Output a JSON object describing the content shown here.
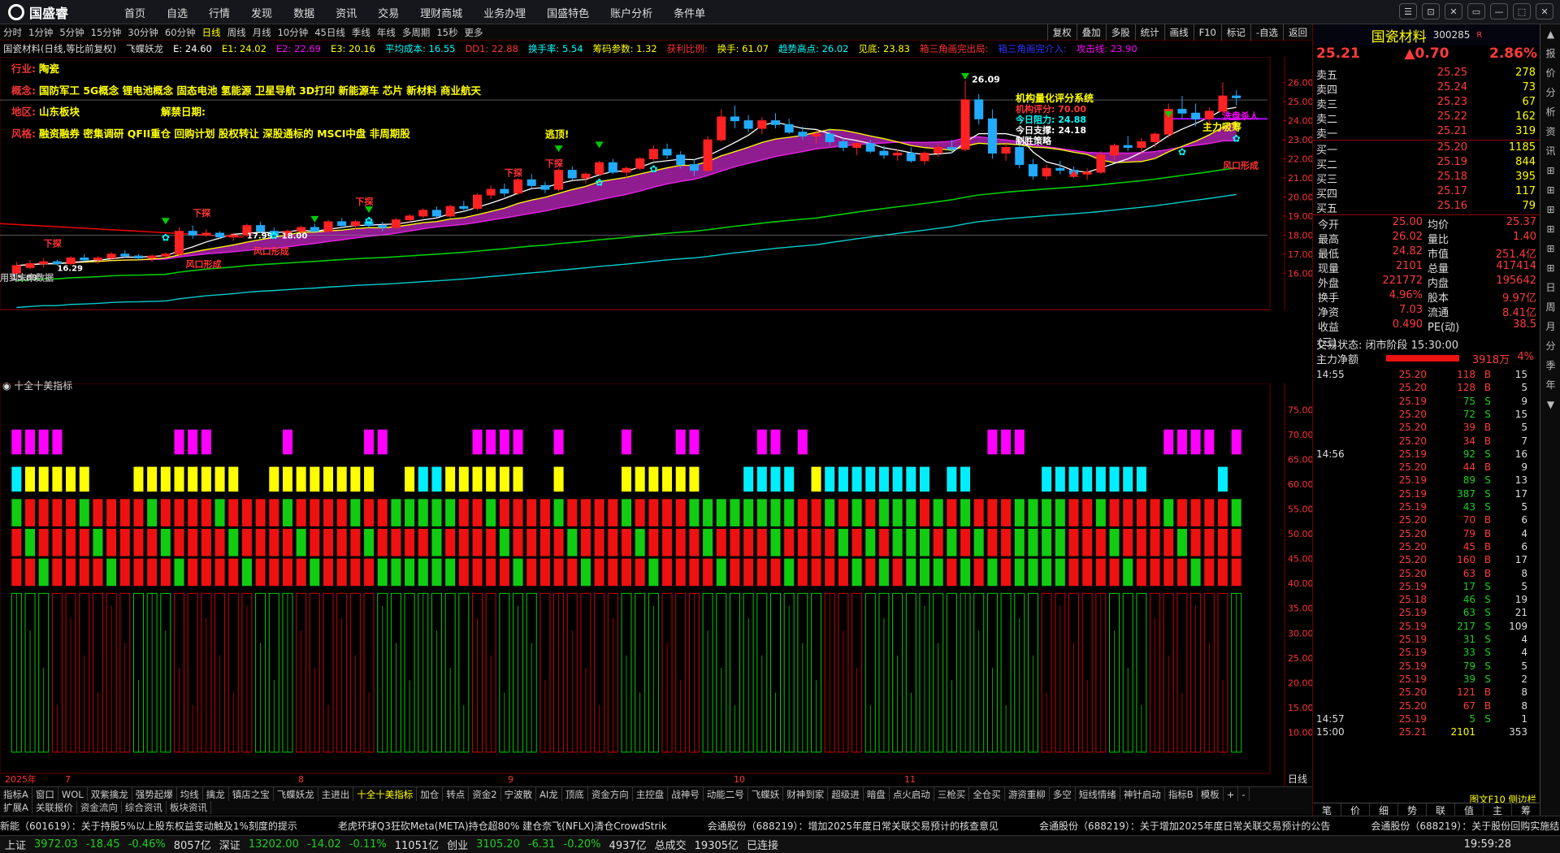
{
  "app": {
    "logo": "国盛睿"
  },
  "menu": [
    "首页",
    "自选",
    "行情",
    "发现",
    "数据",
    "资讯",
    "交易",
    "理财商城",
    "业务办理",
    "国盛特色",
    "账户分析",
    "条件单"
  ],
  "window_buttons": [
    "☰",
    "⊡",
    "✕",
    "▭",
    "—",
    "⬚",
    "✕"
  ],
  "periods": [
    "分时",
    "1分钟",
    "5分钟",
    "15分钟",
    "30分钟",
    "60分钟",
    "日线",
    "周线",
    "月线",
    "10分钟",
    "45日线",
    "季线",
    "年线",
    "多周期",
    "15秒",
    "更多"
  ],
  "active_period": "日线",
  "right_tools": [
    "复权",
    "叠加",
    "多股",
    "统计",
    "画线",
    "F10",
    "标记",
    "-自选",
    "返回"
  ],
  "indicator_line": [
    {
      "t": "国瓷材料(日线,等比前复权)",
      "c": "#ddd"
    },
    {
      "t": "飞蝶妖龙",
      "c": "#ddd"
    },
    {
      "t": "E: 24.60",
      "c": "#fff"
    },
    {
      "t": "E1: 24.02",
      "c": "#ff0"
    },
    {
      "t": "E2: 22.69",
      "c": "#f0f"
    },
    {
      "t": "E3: 20.16",
      "c": "#ff0"
    },
    {
      "t": "平均成本: 16.55",
      "c": "#0ff"
    },
    {
      "t": "DD1: 22.88",
      "c": "#f33"
    },
    {
      "t": "换手率: 5.54",
      "c": "#0ff"
    },
    {
      "t": "筹码参数: 1.32",
      "c": "#ff0"
    },
    {
      "t": "获利比例:",
      "c": "#f33"
    },
    {
      "t": "换手: 61.07",
      "c": "#ff0"
    },
    {
      "t": "趋势高点: 26.02",
      "c": "#0ff"
    },
    {
      "t": "见底: 23.83",
      "c": "#ff0"
    },
    {
      "t": "箱三角画完出局:",
      "c": "#f33"
    },
    {
      "t": "箱三角画完介入:",
      "c": "#33f"
    },
    {
      "t": "攻击线: 23.90",
      "c": "#f0f"
    }
  ],
  "info": [
    {
      "label": "行业:",
      "value": "陶瓷"
    },
    {
      "label": "概念:",
      "value": "国防军工 5G概念 锂电池概念 固态电池 氢能源 卫星导航 3D打印 新能源车 芯片 新材料 商业航天"
    },
    {
      "label": "地区:",
      "value": "山东板块",
      "extra_label": "解禁日期:"
    },
    {
      "label": "风格:",
      "value": "融资融券 密集调研 QFII重仓 回购计划 股权转让 深股通标的 MSCI中盘 非周期股"
    }
  ],
  "price_axis": [
    "26.00",
    "25.00",
    "24.00",
    "23.00",
    "22.00",
    "21.00",
    "20.00",
    "19.00",
    "18.00",
    "17.00",
    "16.00"
  ],
  "sub_axis": [
    "75.00",
    "70.00",
    "65.00",
    "60.00",
    "55.00",
    "50.00",
    "45.00",
    "40.00",
    "35.00",
    "30.00",
    "25.00",
    "20.00",
    "15.00",
    "10.00"
  ],
  "chart_annotations": {
    "high": "26.09",
    "low": "15.89",
    "low2": "16.29",
    "mid": "17.99 - 18.00",
    "no_future": "用到未来数据",
    "escape": "逃顶!",
    "xiatan": "下探",
    "fengkou": "风口形成",
    "zhuli": "主力吸筹",
    "xipan": "洗盘杀人",
    "system_title": "机构量化评分系统",
    "system_score": "机构评分: 70.00",
    "today_resist": "今日阻力: 24.88",
    "today_support": "今日支撑: 24.18",
    "strategy": "制胜策略"
  },
  "sub_title": "十全十美指标",
  "date_axis": [
    "2025年",
    "7",
    "8",
    "9",
    "10",
    "11"
  ],
  "day_label": "日线",
  "chart_data": {
    "type": "candlestick",
    "title": "国瓷材料(日线,等比前复权)",
    "ylim": [
      15.5,
      26.5
    ],
    "ohlc": [
      [
        16.0,
        16.6,
        15.9,
        16.4
      ],
      [
        16.3,
        16.7,
        16.2,
        16.5
      ],
      [
        16.5,
        16.8,
        16.3,
        16.6
      ],
      [
        16.6,
        16.7,
        16.4,
        16.5
      ],
      [
        16.5,
        16.9,
        16.4,
        16.8
      ],
      [
        16.8,
        17.0,
        16.6,
        16.7
      ],
      [
        16.7,
        16.9,
        16.5,
        16.8
      ],
      [
        16.8,
        17.1,
        16.7,
        17.0
      ],
      [
        17.0,
        17.2,
        16.8,
        16.9
      ],
      [
        16.9,
        17.0,
        16.7,
        16.8
      ],
      [
        16.8,
        17.0,
        16.6,
        16.9
      ],
      [
        16.9,
        17.1,
        16.8,
        17.0
      ],
      [
        17.0,
        18.4,
        16.9,
        18.2
      ],
      [
        18.2,
        18.5,
        17.8,
        18.0
      ],
      [
        18.0,
        18.3,
        17.9,
        18.1
      ],
      [
        18.1,
        18.2,
        17.8,
        17.9
      ],
      [
        17.9,
        18.1,
        17.7,
        18.0
      ],
      [
        18.0,
        18.6,
        17.9,
        18.5
      ],
      [
        18.5,
        18.7,
        18.1,
        18.2
      ],
      [
        18.2,
        18.4,
        17.9,
        18.0
      ],
      [
        18.0,
        18.3,
        17.9,
        18.2
      ],
      [
        18.2,
        18.5,
        18.0,
        18.4
      ],
      [
        18.4,
        18.6,
        18.1,
        18.2
      ],
      [
        18.2,
        18.8,
        18.1,
        18.7
      ],
      [
        18.7,
        18.9,
        18.4,
        18.5
      ],
      [
        18.5,
        18.8,
        18.3,
        18.7
      ],
      [
        18.7,
        18.9,
        18.4,
        18.5
      ],
      [
        18.5,
        18.7,
        18.2,
        18.4
      ],
      [
        18.4,
        18.9,
        18.3,
        18.8
      ],
      [
        18.8,
        19.1,
        18.6,
        19.0
      ],
      [
        19.0,
        19.4,
        18.9,
        19.3
      ],
      [
        19.3,
        19.5,
        18.9,
        19.0
      ],
      [
        19.0,
        19.6,
        18.9,
        19.5
      ],
      [
        19.5,
        19.8,
        19.2,
        19.4
      ],
      [
        19.4,
        20.2,
        19.3,
        20.1
      ],
      [
        20.1,
        20.6,
        19.9,
        20.4
      ],
      [
        20.4,
        20.7,
        20.0,
        20.2
      ],
      [
        20.2,
        21.0,
        20.1,
        20.9
      ],
      [
        20.9,
        21.2,
        20.5,
        20.6
      ],
      [
        20.6,
        20.8,
        20.2,
        20.4
      ],
      [
        20.4,
        21.5,
        20.3,
        21.4
      ],
      [
        21.4,
        21.6,
        20.9,
        21.0
      ],
      [
        21.0,
        21.3,
        20.7,
        21.2
      ],
      [
        21.2,
        21.9,
        21.1,
        21.8
      ],
      [
        21.8,
        22.0,
        21.2,
        21.3
      ],
      [
        21.3,
        21.6,
        21.0,
        21.5
      ],
      [
        21.5,
        22.1,
        21.4,
        22.0
      ],
      [
        22.0,
        22.7,
        21.9,
        22.5
      ],
      [
        22.5,
        22.8,
        22.0,
        22.2
      ],
      [
        22.2,
        22.4,
        21.5,
        21.7
      ],
      [
        21.7,
        22.0,
        21.1,
        21.4
      ],
      [
        21.4,
        23.2,
        21.3,
        23.0
      ],
      [
        23.0,
        24.6,
        22.9,
        24.2
      ],
      [
        24.2,
        24.8,
        23.6,
        24.0
      ],
      [
        24.0,
        24.3,
        23.4,
        23.6
      ],
      [
        23.6,
        24.2,
        23.3,
        24.0
      ],
      [
        24.0,
        24.4,
        23.6,
        23.8
      ],
      [
        23.8,
        24.1,
        23.3,
        23.4
      ],
      [
        23.4,
        23.7,
        23.0,
        23.2
      ],
      [
        23.2,
        23.5,
        22.8,
        23.3
      ],
      [
        23.3,
        23.6,
        22.7,
        22.9
      ],
      [
        22.9,
        23.1,
        22.4,
        22.6
      ],
      [
        22.6,
        22.9,
        22.2,
        22.8
      ],
      [
        22.8,
        23.0,
        22.3,
        22.4
      ],
      [
        22.4,
        22.7,
        22.0,
        22.2
      ],
      [
        22.2,
        22.5,
        21.9,
        22.3
      ],
      [
        22.3,
        22.6,
        21.8,
        21.9
      ],
      [
        21.9,
        22.4,
        21.7,
        22.3
      ],
      [
        22.3,
        22.8,
        22.1,
        22.6
      ],
      [
        22.6,
        23.0,
        22.3,
        22.5
      ],
      [
        22.5,
        26.09,
        22.4,
        25.1
      ],
      [
        25.1,
        25.4,
        23.8,
        24.1
      ],
      [
        24.1,
        24.6,
        22.0,
        22.3
      ],
      [
        22.3,
        22.8,
        21.9,
        22.6
      ],
      [
        22.6,
        22.9,
        21.5,
        21.7
      ],
      [
        21.7,
        22.0,
        20.9,
        21.1
      ],
      [
        21.1,
        21.7,
        20.9,
        21.5
      ],
      [
        21.5,
        21.9,
        21.2,
        21.4
      ],
      [
        21.4,
        21.6,
        21.0,
        21.2
      ],
      [
        21.2,
        21.5,
        20.9,
        21.3
      ],
      [
        21.3,
        22.4,
        21.2,
        22.2
      ],
      [
        22.2,
        22.8,
        21.9,
        22.7
      ],
      [
        22.7,
        23.2,
        22.4,
        22.6
      ],
      [
        22.6,
        23.1,
        22.3,
        22.9
      ],
      [
        22.9,
        23.4,
        22.6,
        23.3
      ],
      [
        23.3,
        24.9,
        23.1,
        24.6
      ],
      [
        24.6,
        25.3,
        24.1,
        24.4
      ],
      [
        24.4,
        24.9,
        23.7,
        24.1
      ],
      [
        24.1,
        24.7,
        23.6,
        24.5
      ],
      [
        24.5,
        26.02,
        24.3,
        25.3
      ],
      [
        25.3,
        25.6,
        24.8,
        25.21
      ]
    ]
  },
  "rp": {
    "name": "国瓷材料",
    "code": "300285",
    "sup": "R",
    "price": "25.21",
    "change": "▲0.70",
    "pct": "2.86%",
    "asks": [
      {
        "l": "卖五",
        "p": "25.25",
        "v": "278"
      },
      {
        "l": "卖四",
        "p": "25.24",
        "v": "73"
      },
      {
        "l": "卖三",
        "p": "25.23",
        "v": "67"
      },
      {
        "l": "卖二",
        "p": "25.22",
        "v": "162"
      },
      {
        "l": "卖一",
        "p": "25.21",
        "v": "319"
      }
    ],
    "bids": [
      {
        "l": "买一",
        "p": "25.20",
        "v": "1185"
      },
      {
        "l": "买二",
        "p": "25.19",
        "v": "844"
      },
      {
        "l": "买三",
        "p": "25.18",
        "v": "395"
      },
      {
        "l": "买四",
        "p": "25.17",
        "v": "117"
      },
      {
        "l": "买五",
        "p": "25.16",
        "v": "79"
      }
    ],
    "stats": [
      {
        "a": "今开",
        "b": "25.00",
        "c": "均价",
        "d": "25.37"
      },
      {
        "a": "最高",
        "b": "26.02",
        "c": "量比",
        "d": "1.40"
      },
      {
        "a": "最低",
        "b": "24.82",
        "c": "市值",
        "d": "251.4亿"
      },
      {
        "a": "现量",
        "b": "2101",
        "c": "总量",
        "d": "417414"
      },
      {
        "a": "外盘",
        "b": "221772",
        "c": "内盘",
        "d": "195642"
      },
      {
        "a": "换手",
        "b": "4.96%",
        "c": "股本",
        "d": "9.97亿"
      },
      {
        "a": "净资",
        "b": "7.03",
        "c": "流通",
        "d": "8.41亿"
      },
      {
        "a": "收益(三)",
        "b": "0.490",
        "c": "PE(动)",
        "d": "38.5"
      }
    ],
    "trade_state": "交易状态: 闭市阶段 15:30:00",
    "net_label": "主力净额",
    "net_value": "3918万",
    "net_pct": "4%",
    "ticks": [
      {
        "t": "14:55",
        "p": "25.20",
        "v": "118",
        "d": "B",
        "n": "15"
      },
      {
        "t": "",
        "p": "25.20",
        "v": "128",
        "d": "B",
        "n": "5"
      },
      {
        "t": "",
        "p": "25.19",
        "v": "75",
        "d": "S",
        "n": "9"
      },
      {
        "t": "",
        "p": "25.20",
        "v": "72",
        "d": "S",
        "n": "15"
      },
      {
        "t": "",
        "p": "25.20",
        "v": "39",
        "d": "B",
        "n": "5"
      },
      {
        "t": "",
        "p": "25.20",
        "v": "34",
        "d": "B",
        "n": "7"
      },
      {
        "t": "14:56",
        "p": "25.19",
        "v": "92",
        "d": "S",
        "n": "16"
      },
      {
        "t": "",
        "p": "25.20",
        "v": "44",
        "d": "B",
        "n": "9"
      },
      {
        "t": "",
        "p": "25.19",
        "v": "89",
        "d": "S",
        "n": "13"
      },
      {
        "t": "",
        "p": "25.19",
        "v": "387",
        "d": "S",
        "n": "17"
      },
      {
        "t": "",
        "p": "25.19",
        "v": "43",
        "d": "S",
        "n": "5"
      },
      {
        "t": "",
        "p": "25.20",
        "v": "70",
        "d": "B",
        "n": "6"
      },
      {
        "t": "",
        "p": "25.20",
        "v": "79",
        "d": "B",
        "n": "4"
      },
      {
        "t": "",
        "p": "25.20",
        "v": "45",
        "d": "B",
        "n": "6"
      },
      {
        "t": "",
        "p": "25.20",
        "v": "160",
        "d": "B",
        "n": "17"
      },
      {
        "t": "",
        "p": "25.20",
        "v": "63",
        "d": "B",
        "n": "8"
      },
      {
        "t": "",
        "p": "25.19",
        "v": "17",
        "d": "S",
        "n": "5"
      },
      {
        "t": "",
        "p": "25.18",
        "v": "46",
        "d": "S",
        "n": "19"
      },
      {
        "t": "",
        "p": "25.19",
        "v": "63",
        "d": "S",
        "n": "21"
      },
      {
        "t": "",
        "p": "25.19",
        "v": "217",
        "d": "S",
        "n": "109"
      },
      {
        "t": "",
        "p": "25.19",
        "v": "31",
        "d": "S",
        "n": "4"
      },
      {
        "t": "",
        "p": "25.19",
        "v": "33",
        "d": "S",
        "n": "4"
      },
      {
        "t": "",
        "p": "25.19",
        "v": "79",
        "d": "S",
        "n": "5"
      },
      {
        "t": "",
        "p": "25.19",
        "v": "39",
        "d": "S",
        "n": "2"
      },
      {
        "t": "",
        "p": "25.20",
        "v": "121",
        "d": "B",
        "n": "8"
      },
      {
        "t": "",
        "p": "25.20",
        "v": "67",
        "d": "B",
        "n": "8"
      },
      {
        "t": "14:57",
        "p": "25.19",
        "v": "5",
        "d": "S",
        "n": "1"
      },
      {
        "t": "15:00",
        "p": "25.21",
        "v": "2101",
        "d": "",
        "n": "353"
      }
    ],
    "bottom_tabs": [
      "笔",
      "价",
      "细",
      "势",
      "联",
      "值",
      "主",
      "筹"
    ],
    "bottom_right": "图文F10 侧边栏"
  },
  "sidebar": [
    "▲",
    "报",
    "价",
    "分",
    "析",
    "资",
    "讯",
    "⊞",
    "⊞",
    "⊞",
    "⊞",
    "⊞",
    "⊞",
    "日",
    "周",
    "月",
    "分",
    "季",
    "年",
    "▼"
  ],
  "bottom_tabs": [
    "指标A",
    "窗口",
    "WOL",
    "双紫擒龙",
    "强势起爆",
    "均线",
    "擒龙",
    "镇店之宝",
    "飞蝶妖龙",
    "主进出",
    "十全十美指标",
    "加仓",
    "转点",
    "资金2",
    "宁波散",
    "AI龙",
    "顶底",
    "资金方向",
    "主控盘",
    "战神号",
    "动能二号",
    "飞蝶妖",
    "财神到家",
    "超级进",
    "暗盘",
    "点火启动",
    "三枪买",
    "全仓买",
    "游资重柳",
    "多空",
    "短线情绪",
    "神针启动",
    "指标B",
    "模板",
    "+",
    "-"
  ],
  "active_bottom_tab": "十全十美指标",
  "tabs2": [
    "扩展A",
    "关联报价",
    "资金流向",
    "综合资讯",
    "板块资讯"
  ],
  "ticker": [
    "新能（601619）：关于持股5%以上股东权益变动触及1%刻度的提示",
    "老虎环球Q3狂砍Meta(META)持仓超80% 建仓奈飞(NFLX)清仓CrowdStrik",
    "会通股份（688219）：增加2025年度日常关联交易预计的核查意见",
    "会通股份（688219）：关于增加2025年度日常关联交易预计的公告",
    "会通股份（688219）：关于股份回购实施结果暨股份变动的"
  ],
  "status": {
    "sh_label": "上证",
    "sh": "3972.03",
    "sh_ch": "-18.45",
    "sh_pct": "-0.46%",
    "sh_amt": "8057亿",
    "sz_label": "深证",
    "sz": "13202.00",
    "sz_ch": "-14.02",
    "sz_pct": "-0.11%",
    "sz_amt": "11051亿",
    "cy_label": "创业",
    "cy": "3105.20",
    "cy_ch": "-6.31",
    "cy_pct": "-0.20%",
    "cy_amt": "4937亿",
    "total_label": "总成交",
    "total": "19305亿",
    "conn": "已连接",
    "time": "19:59:28"
  }
}
